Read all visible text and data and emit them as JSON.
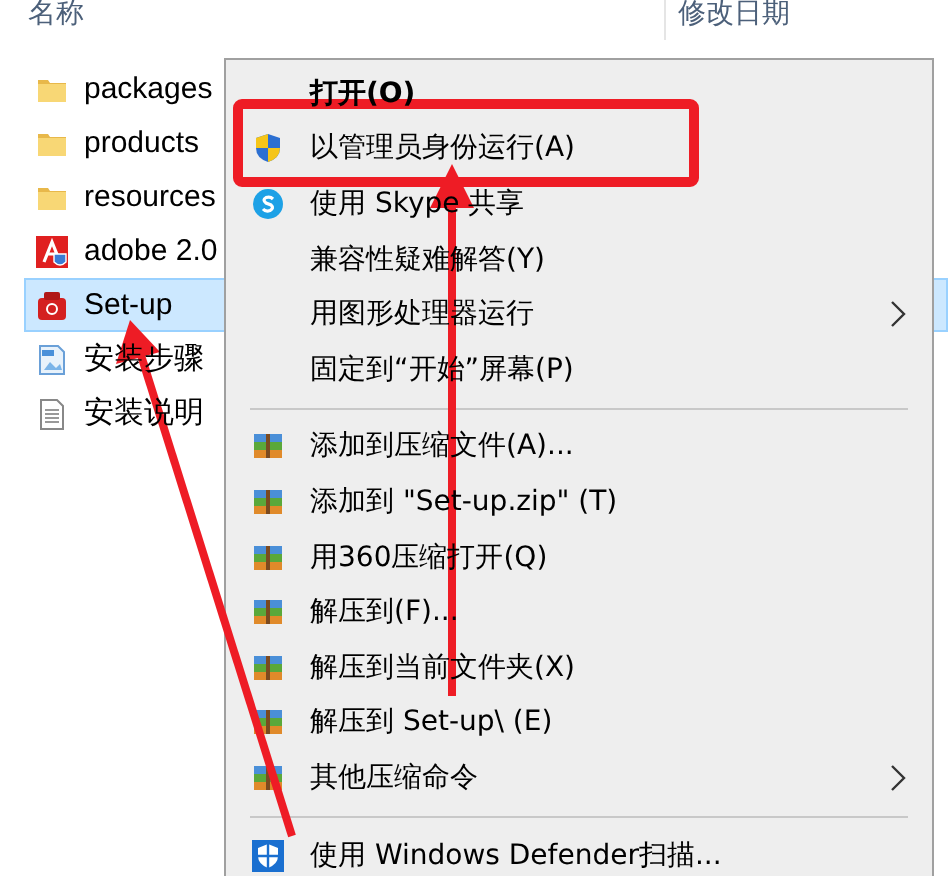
{
  "columns": [
    {
      "label": "名称"
    },
    {
      "label": "修改日期"
    }
  ],
  "files": [
    {
      "name": "packages",
      "kind": "folder",
      "selected": false
    },
    {
      "name": "products",
      "kind": "folder",
      "selected": false
    },
    {
      "name": "resources",
      "kind": "folder",
      "selected": false
    },
    {
      "name": "adobe 2.0",
      "kind": "adobe",
      "selected": false
    },
    {
      "name": "Set-up",
      "kind": "setup",
      "selected": true
    },
    {
      "name": "安装步骤",
      "kind": "image",
      "selected": false
    },
    {
      "name": "安装说明",
      "kind": "text",
      "selected": false
    }
  ],
  "context_menu": [
    {
      "kind": "item",
      "label": "打开(O)",
      "default": true,
      "submenu": false
    },
    {
      "kind": "item",
      "label": "以管理员身份运行(A)",
      "default": false,
      "submenu": false
    },
    {
      "kind": "item",
      "label": "使用 Skype 共享",
      "default": false,
      "submenu": false
    },
    {
      "kind": "item",
      "label": "兼容性疑难解答(Y)",
      "default": false,
      "submenu": false
    },
    {
      "kind": "item",
      "label": "用图形处理器运行",
      "default": false,
      "submenu": true
    },
    {
      "kind": "item",
      "label": "固定到“开始”屏幕(P)",
      "default": false,
      "submenu": false
    },
    {
      "kind": "separator"
    },
    {
      "kind": "item",
      "label": "添加到压缩文件(A)...",
      "default": false,
      "submenu": false
    },
    {
      "kind": "item",
      "label": "添加到 \"Set-up.zip\" (T)",
      "default": false,
      "submenu": false
    },
    {
      "kind": "item",
      "label": "用360压缩打开(Q)",
      "default": false,
      "submenu": false
    },
    {
      "kind": "item",
      "label": "解压到(F)...",
      "default": false,
      "submenu": false
    },
    {
      "kind": "item",
      "label": "解压到当前文件夹(X)",
      "default": false,
      "submenu": false
    },
    {
      "kind": "item",
      "label": "解压到 Set-up\\ (E)",
      "default": false,
      "submenu": false
    },
    {
      "kind": "item",
      "label": "其他压缩命令",
      "default": false,
      "submenu": true
    },
    {
      "kind": "separator"
    },
    {
      "kind": "item",
      "label": "使用 Windows Defender扫描...",
      "default": false,
      "submenu": false
    }
  ]
}
